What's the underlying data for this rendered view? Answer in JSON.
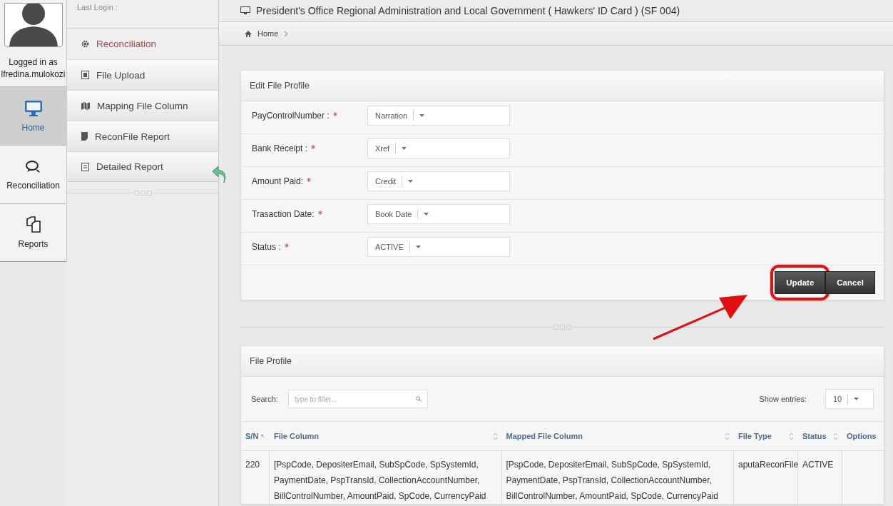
{
  "user": {
    "last_login_label": "Last Login :",
    "logged_in_label": "Logged in as",
    "username": "lfredina.mulokozi"
  },
  "nav": [
    {
      "label": "Home",
      "kind": "monitor",
      "selected": true
    },
    {
      "label": "Reconciliation",
      "kind": "chat",
      "selected": false
    },
    {
      "label": "Reports",
      "kind": "copy",
      "selected": false
    }
  ],
  "menu": {
    "title": "Reconciliation",
    "items": [
      {
        "label": "File Upload",
        "kind": "upload"
      },
      {
        "label": "Mapping File Column",
        "kind": "map"
      },
      {
        "label": "ReconFile Report",
        "kind": "file"
      },
      {
        "label": "Detailed Report",
        "kind": "report"
      }
    ]
  },
  "header": {
    "title": "President's Office Regional Administration and Local Government ( Hawkers' ID Card ) (SF 004)"
  },
  "breadcrumb": [
    "Home"
  ],
  "edit_form": {
    "title": "Edit File Profile",
    "fields": [
      {
        "label": "PayControlNumber :",
        "required": true,
        "value": "Narration"
      },
      {
        "label": "Bank Receipt :",
        "required": true,
        "value": "Xref"
      },
      {
        "label": "Amount Paid:",
        "required": true,
        "value": "Credit"
      },
      {
        "label": "Trasaction Date:",
        "required": true,
        "value": "Book Date"
      },
      {
        "label": "Status :",
        "required": true,
        "value": "ACTIVE"
      }
    ],
    "buttons": [
      {
        "label": "Update",
        "highlighted": true
      },
      {
        "label": "Cancel",
        "highlighted": false
      }
    ]
  },
  "file_profile": {
    "title": "File Profile",
    "search": {
      "label": "Search:",
      "placeholder": "type to filter..."
    },
    "entries": {
      "label": "Show entries:",
      "value": "10"
    },
    "table": {
      "columns": [
        {
          "label": "S/N",
          "sorted": true
        },
        {
          "label": "File Column",
          "sorted": false
        },
        {
          "label": "Mapped File Column",
          "sorted": false
        },
        {
          "label": "File Type",
          "sorted": false
        },
        {
          "label": "Status",
          "sorted": false
        },
        {
          "label": "Options",
          "sorted": false
        }
      ],
      "rows": [
        {
          "cells": [
            "220",
            "[PspCode, DepositerEmail, SubSpCode, SpSystemId, PaymentDate, PspTransId, CollectionAccountNumber, BillControlNumber, AmountPaid, SpCode, CurrencyPaid",
            "[PspCode, DepositerEmail, SubSpCode, SpSystemId, PaymentDate, PspTransId, CollectionAccountNumber, BillControlNumber, AmountPaid, SpCode, CurrencyPaid",
            "aputaReconFile",
            "ACTIVE",
            ""
          ]
        }
      ]
    }
  }
}
